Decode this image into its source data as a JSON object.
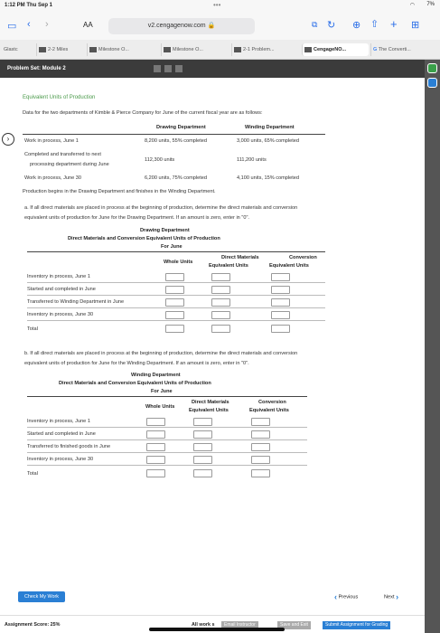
{
  "status": {
    "time": "1:12 PM  Thu Sep 1",
    "dots": "•••",
    "battery": "7%"
  },
  "browser": {
    "text_size": "AA",
    "url": "v2.cengagenow.com",
    "tabs": [
      "Glastc",
      "2-2 Miles",
      "Milestone O...",
      "Milestone O...",
      "2-1 Problem...",
      "CengageNO...",
      "The Converti..."
    ]
  },
  "app": {
    "title": "Problem Set: Module 2"
  },
  "problem": {
    "heading": "Equivalent Units of Production",
    "intro": "Data for the two departments of Kimble & Pierce Company for June of the current fiscal year are as follows:",
    "data_table": {
      "col1": "Drawing Department",
      "col2": "Winding Department",
      "rows": [
        {
          "label": "Work in process, June 1",
          "d": "8,200 units, 55% completed",
          "w": "3,000 units, 65% completed"
        },
        {
          "label": "Completed and transferred to next",
          "label2": "processing department during June",
          "d": "112,300 units",
          "w": "111,200 units"
        },
        {
          "label": "Work in process, June 30",
          "d": "6,200 units, 75% completed",
          "w": "4,100 units, 15% completed"
        }
      ],
      "note": "Production begins in the Drawing Department and finishes in the Winding Department."
    },
    "part_a": {
      "q1": "a.  If all direct materials are placed in process at the beginning of production, determine the direct materials and conversion",
      "q2": "equivalent units of production for June for the Drawing Department. If an amount is zero, enter in \"0\".",
      "title1": "Drawing Department",
      "title2": "Direct Materials and Conversion Equivalent Units of Production",
      "title3": "For June",
      "h_whole": "Whole Units",
      "h_dm1": "Direct Materials",
      "h_dm2": "Equivalent Units",
      "h_cv1": "Conversion",
      "h_cv2": "Equivalent Units",
      "rows": [
        "Inventory in process, June 1",
        "Started and completed in June",
        "Transferred to Winding Department in June",
        "Inventory in process, June 30",
        "Total"
      ]
    },
    "part_b": {
      "q1": "b.  If all direct materials are placed in process at the beginning of production, determine the direct materials and conversion",
      "q2": "equivalent units of production for June for the Winding Department. If an amount is zero, enter in \"0\".",
      "title1": "Winding Department",
      "title2": "Direct Materials and Conversion Equivalent Units of Production",
      "title3": "For June",
      "h_whole": "Whole Units",
      "h_dm1": "Direct Materials",
      "h_dm2": "Equivalent Units",
      "h_cv1": "Conversion",
      "h_cv2": "Equivalent Units",
      "rows": [
        "Inventory in process, June 1",
        "Started and completed in June",
        "Transferred to finished goods in June",
        "Inventory in process, June 30",
        "Total"
      ]
    }
  },
  "nav": {
    "check": "Check My Work",
    "previous": "Previous",
    "next": "Next"
  },
  "footer": {
    "score": "Assignment Score:  25%",
    "all_work": "All work s",
    "email": "Email Instructor",
    "save": "Save and Exit",
    "submit": "Submit Assignment for Grading"
  },
  "colors": {
    "accent": "#2a7fd4",
    "heading_green": "#4a9a4a",
    "titlebar": "#3b3b3b"
  }
}
